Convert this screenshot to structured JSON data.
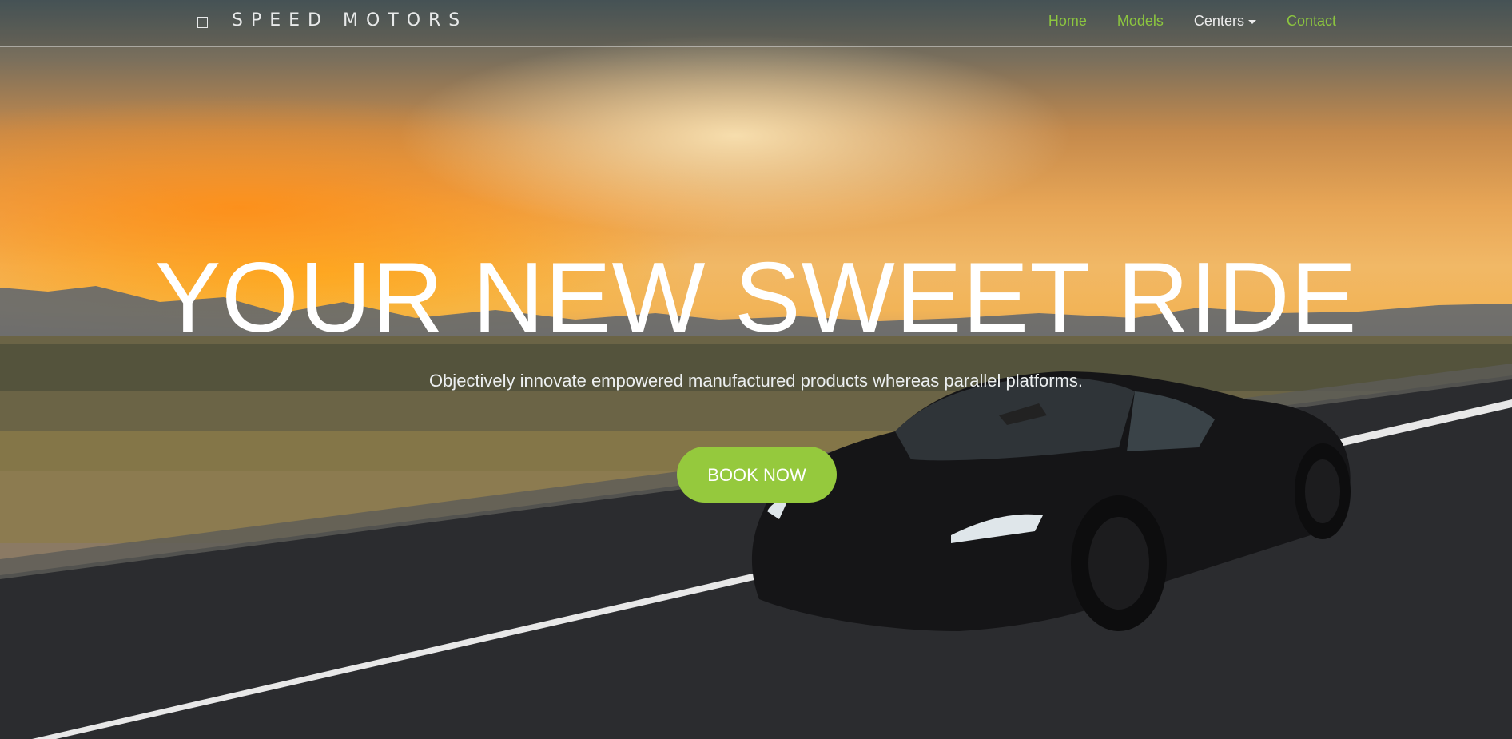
{
  "brand": {
    "name": "SPEED MOTORS",
    "icon": "brand-square-icon"
  },
  "nav": {
    "items": [
      {
        "label": "Home"
      },
      {
        "label": "Models"
      },
      {
        "label": "Centers",
        "has_dropdown": true
      },
      {
        "label": "Contact"
      }
    ]
  },
  "hero": {
    "headline": "YOUR NEW SWEET RIDE",
    "subheadline": "Objectively innovate empowered manufactured products whereas parallel platforms.",
    "cta_label": "BOOK NOW"
  },
  "colors": {
    "accent": "#95c93d",
    "nav_active": "#8cc63f",
    "text": "#ffffff"
  }
}
